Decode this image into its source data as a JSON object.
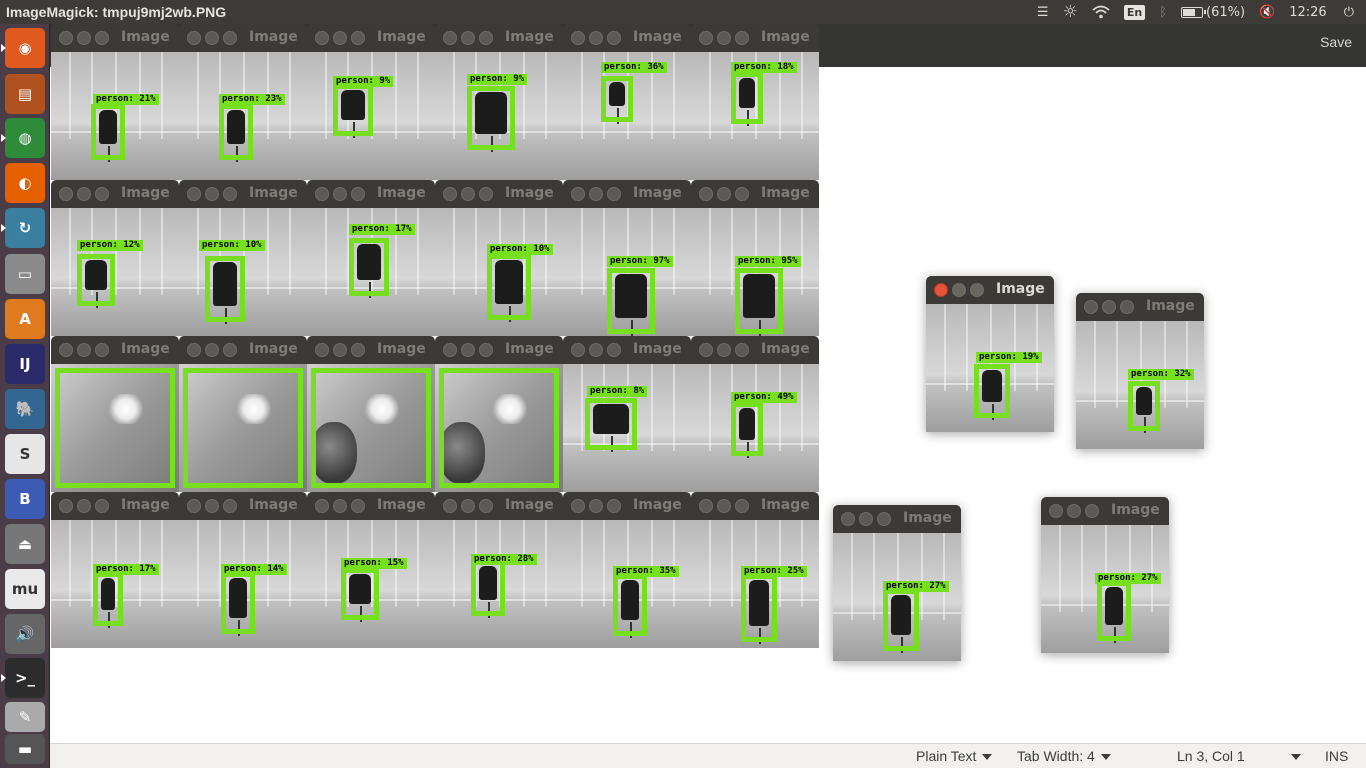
{
  "window_title": "ImageMagick: tmpuj9mj2wb.PNG",
  "tray": {
    "keyboard_layout": "En",
    "battery_text": "(61%)",
    "battery_level": 0.61,
    "clock": "12:26"
  },
  "launcher_apps": [
    {
      "name": "ubuntu-dash-icon",
      "glyph": "◉",
      "color": "#e0591f"
    },
    {
      "name": "files-icon",
      "glyph": "▤",
      "color": "#b0521f"
    },
    {
      "name": "chrome-icon",
      "glyph": "◍",
      "color": "#2e8b3a"
    },
    {
      "name": "firefox-icon",
      "glyph": "◐",
      "color": "#e66000"
    },
    {
      "name": "synaptic-icon",
      "glyph": "↻",
      "color": "#3a7fa0"
    },
    {
      "name": "disk-icon",
      "glyph": "▭",
      "color": "#8a8a8a"
    },
    {
      "name": "software-center-icon",
      "glyph": "A",
      "color": "#e07a1f"
    },
    {
      "name": "intellij-icon",
      "glyph": "IJ",
      "color": "#2b2b6b"
    },
    {
      "name": "pgadmin-icon",
      "glyph": "🐘",
      "color": "#336791"
    },
    {
      "name": "slack-icon",
      "glyph": "S",
      "color": "#e6e6e6"
    },
    {
      "name": "atom-icon",
      "glyph": "B",
      "color": "#3d5bb5"
    },
    {
      "name": "usb-icon",
      "glyph": "⏏",
      "color": "#777777"
    },
    {
      "name": "mu-editor-icon",
      "glyph": "mu",
      "color": "#eaeaea"
    },
    {
      "name": "sound-icon",
      "glyph": "🔊",
      "color": "#666666"
    },
    {
      "name": "terminal-icon",
      "glyph": ">_",
      "color": "#2c2c2c"
    },
    {
      "name": "text-editor-icon",
      "glyph": "✎",
      "color": "#aaaaaa"
    },
    {
      "name": "display-icon",
      "glyph": "▬",
      "color": "#555555"
    }
  ],
  "window_label": "Image",
  "editor": {
    "save_label": "Save",
    "status": {
      "language": "Plain Text",
      "tab_width": "Tab Width: 4",
      "position": "Ln 3, Col 1",
      "mode": "INS"
    }
  },
  "detections": [
    "person: 21%",
    "person: 23%",
    "person: 9%",
    "person: 9%",
    "person: 36%",
    "person: 18%",
    "person: 12%",
    "person: 10%",
    "person: 17%",
    "person: 10%",
    "person: 97%",
    "person: 95%",
    "",
    "",
    "",
    "",
    "person: 8%",
    "person: 49%",
    "person: 17%",
    "person: 14%",
    "person: 15%",
    "person: 28%",
    "person: 35%",
    "person: 25%",
    "person: 19%",
    "person: 32%",
    "person: 27%",
    "person: 27%"
  ]
}
